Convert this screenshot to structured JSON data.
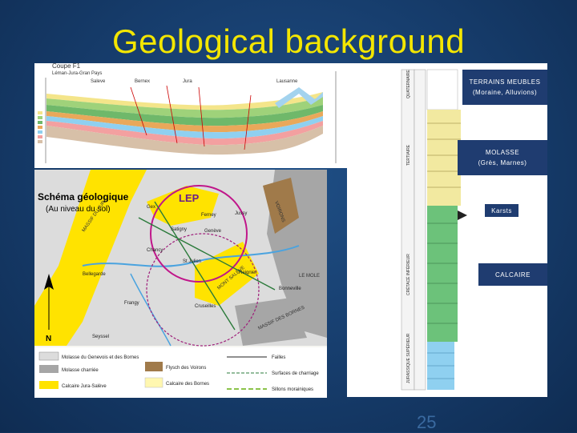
{
  "slide": {
    "title": "Geological background",
    "number": "25"
  },
  "section": {
    "caption_line1": "Coupe F1",
    "caption_line2": "Léman-Jura-Gran Pays",
    "top_labels": [
      "Saleve",
      "Bernex",
      "Jura"
    ],
    "right_label": "Lausanne"
  },
  "map": {
    "title": "Schéma géologique",
    "subtitle": "(Au niveau du sol)",
    "lep_label": "LEP",
    "places": [
      "Genève",
      "Satigny",
      "Chancy",
      "St Julien",
      "Bellegarde",
      "Gex",
      "Ferney",
      "Jussy",
      "Cruseilles",
      "Bonneville",
      "Reignier",
      "Seyssel",
      "Frangy"
    ],
    "features": [
      "MASSIF DU JURA",
      "SALÈVE",
      "MONT SALÈVE",
      "VOIRONS",
      "MASSIF DES BORNES",
      "LE MOLE"
    ],
    "north_label": "N",
    "legend": [
      {
        "label": "Molasse du Genevois et des Bornes",
        "color": "#dcdcdc"
      },
      {
        "label": "Molasse charriée",
        "color": "#a6a6a6"
      },
      {
        "label": "Calcaire Jura-Salève",
        "color": "#ffe300"
      },
      {
        "label": "Flysch des Voirons",
        "color": "#a07a4a"
      },
      {
        "label": "Calcaire des Bornes",
        "color": "#fff7b0"
      }
    ],
    "legend_lines": [
      {
        "label": "Failles",
        "color": "#222222"
      },
      {
        "label": "Surfaces de charriage",
        "color": "#2a7a3a"
      },
      {
        "label": "Sillons morainiques",
        "color": "#8bc34a"
      }
    ],
    "colors": {
      "molasse": "#dcdcdc",
      "charriee": "#a6a6a6",
      "calcaire": "#ffe300",
      "flysch": "#a07a4a",
      "bornes": "#fff7b0",
      "lep_ring": "#c0168a"
    }
  },
  "strat": {
    "labels": {
      "terrains_line1": "TERRAINS MEUBLES",
      "terrains_line2": "(Moraine, Alluvions)",
      "molasse_line1": "MOLASSE",
      "molasse_line2": "(Grès, Marnes)",
      "karsts": "Karsts",
      "calcaire": "CALCAIRE"
    },
    "side_labels": [
      "QUATERNAIRE",
      "TERTIAIRE",
      "CRÉTACÉ INFÉRIEUR",
      "JURASSIQUE SUPÉRIEUR"
    ],
    "colors": {
      "label_bg": "#1f3c70",
      "gravel": "#f2e9a0",
      "molasse": "#d9cf66",
      "calcaire": "#6cc27a",
      "jurassic": "#8fd0f0"
    }
  }
}
